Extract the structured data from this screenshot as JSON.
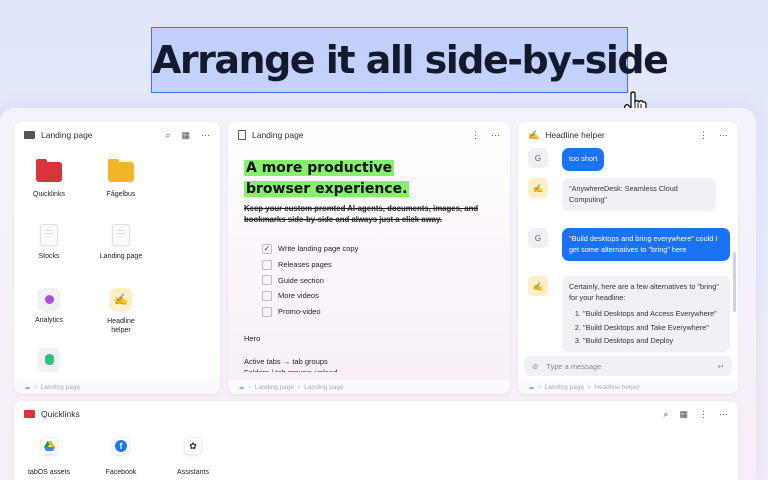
{
  "headline": "Arrange it all side-by-side",
  "left_pane": {
    "title": "Landing page",
    "footer": "Landing page",
    "items": [
      {
        "label": "Quicklinks",
        "icon": "red-folder-icon"
      },
      {
        "label": "Fågelbus",
        "icon": "yellow-folder-icon"
      },
      {
        "label": "Stocks",
        "icon": "document-icon"
      },
      {
        "label": "Landing page",
        "icon": "document-icon"
      },
      {
        "label": "Analytics",
        "icon": "analytics-app-icon"
      },
      {
        "label": "Headline helper",
        "icon": "headline-helper-icon"
      }
    ]
  },
  "middle_pane": {
    "title": "Landing page",
    "highlight_line1": "A more productive",
    "highlight_line2": "browser experience.",
    "strikethrough": "Keep your custom promted AI-agents, documents, images, and bookmarks side-by-side and always just a click away.",
    "checklist": [
      {
        "label": "Write landing page copy",
        "checked": true
      },
      {
        "label": "Releases pages",
        "checked": false
      },
      {
        "label": "Guide section",
        "checked": false
      },
      {
        "label": "More videos",
        "checked": false
      },
      {
        "label": "Promo-video",
        "checked": false
      }
    ],
    "text1": "Hero",
    "text2": "Active tabs → tab groups",
    "text3": "Folders / tab groups: upload",
    "footer": "Landing page",
    "footer_sub": "Landing page"
  },
  "right_pane": {
    "title": "Headline helper",
    "messages": [
      {
        "from": "user",
        "text": "too short"
      },
      {
        "from": "assistant",
        "text": "\"AnywhereDesk: Seamless Cloud Computing\""
      },
      {
        "from": "user",
        "text": "\"Build desktops and bring everywhere\" could I get some alternatives to \"bring\" here"
      },
      {
        "from": "assistant",
        "intro": "Certainly, here are a few alternatives to \"bring\" for your headline:",
        "list": [
          "\"Build Desktops and Access Everywhere\"",
          "\"Build Desktops and Take Everywhere\"",
          "\"Build Desktops and Deploy"
        ]
      }
    ],
    "user_avatar": "G",
    "input_placeholder": "Type a message",
    "footer": "Landing page",
    "footer_sub": "Headline helper"
  },
  "bottom_pane": {
    "title": "Quicklinks",
    "items": [
      {
        "label": "tabOS assets",
        "icon": "google-drive-icon"
      },
      {
        "label": "Facebook",
        "icon": "facebook-icon"
      },
      {
        "label": "Assistants",
        "icon": "openai-icon"
      }
    ]
  },
  "colors": {
    "accent": "#1a73f5",
    "highlight": "#86ef6e"
  }
}
